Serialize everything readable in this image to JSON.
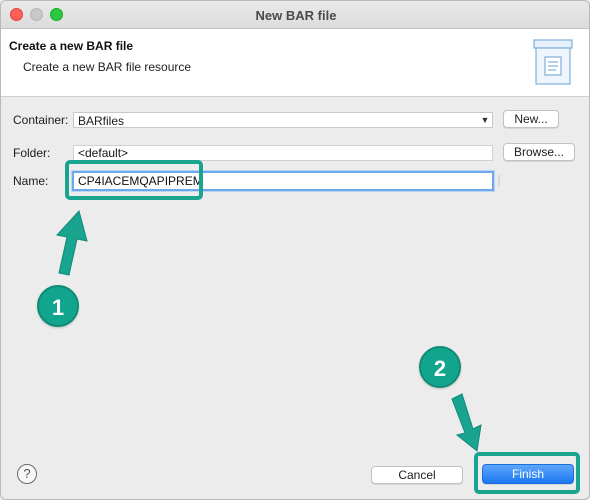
{
  "window": {
    "title": "New BAR file"
  },
  "banner": {
    "heading": "Create a new BAR file",
    "description": "Create a new BAR file resource",
    "icon": "bar-file-wizard-icon"
  },
  "form": {
    "container": {
      "label": "Container:",
      "value": "BARfiles",
      "new_button": "New..."
    },
    "folder": {
      "label": "Folder:",
      "value": "<default>",
      "browse_button": "Browse..."
    },
    "name": {
      "label": "Name:",
      "value": "CP4IACEMQAPIPREM"
    }
  },
  "footer": {
    "help_icon": "question-mark-icon",
    "help_glyph": "?",
    "cancel_button": "Cancel",
    "finish_button": "Finish"
  },
  "annotations": {
    "step_1": "1",
    "step_2": "2",
    "highlight_color": "#19a48f"
  },
  "colors": {
    "accent": "#1b78f2",
    "focus_ring": "#6ea7ec"
  }
}
